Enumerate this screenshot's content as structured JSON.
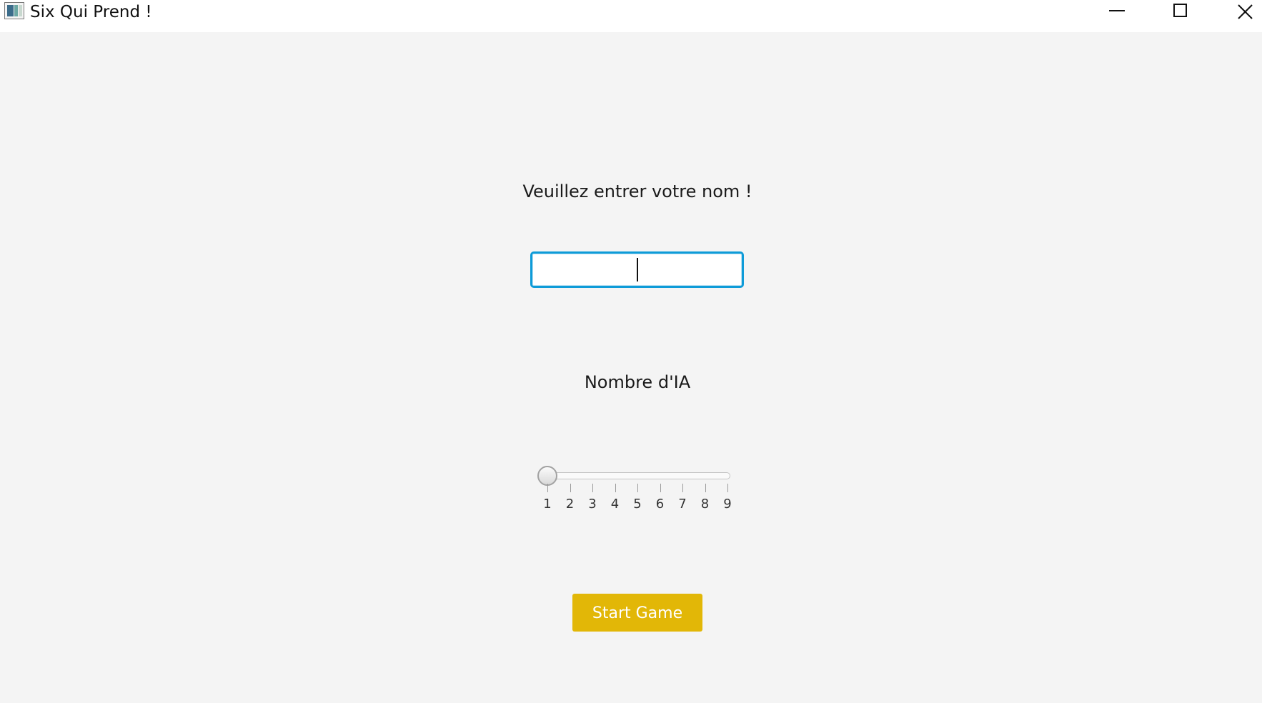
{
  "window": {
    "title": "Six Qui Prend !",
    "controls": [
      "minimize",
      "maximize",
      "close"
    ]
  },
  "form": {
    "name_prompt": "Veuillez entrer votre nom !",
    "name_value": "",
    "ia_label": "Nombre d'IA",
    "slider": {
      "min": 1,
      "max": 9,
      "value": 1,
      "tick_labels": [
        "1",
        "2",
        "3",
        "4",
        "5",
        "6",
        "7",
        "8",
        "9"
      ]
    },
    "start_button": "Start Game"
  },
  "colors": {
    "accent_focus": "#0e9bd8",
    "start_button": "#e2b707",
    "background": "#f4f4f4"
  }
}
